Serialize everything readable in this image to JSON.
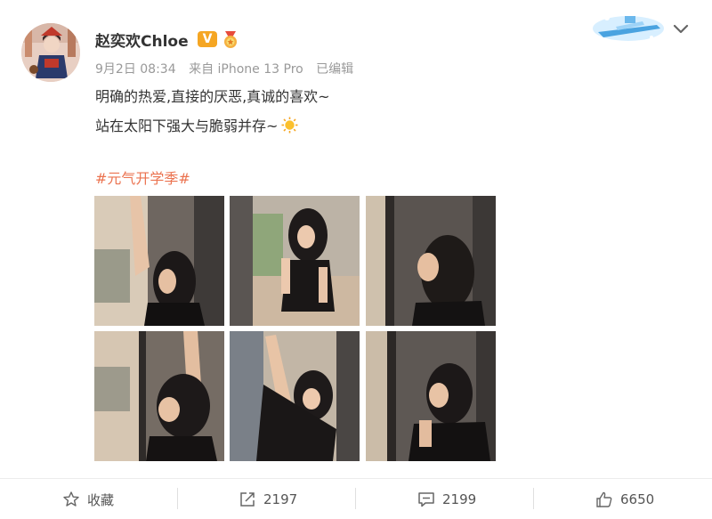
{
  "post": {
    "username": "赵奕欢Chloe",
    "verified_badge": "V",
    "date": "9月2日 08:34",
    "source": "来自 iPhone 13 Pro",
    "edited": "已编辑",
    "line1": "明确的热爱,直接的厌恶,真诚的喜欢~",
    "line2": "站在太阳下强大与脆弱并存~",
    "hashtag": "#元气开学季#"
  },
  "icons": {
    "avatar": "avatar-illustration",
    "medal": "medal-icon",
    "decor": "airship-card-decoration",
    "chevron": "chevron-down-icon",
    "sun": "sun-emoji-icon",
    "star": "star-icon",
    "share": "share-icon",
    "comment": "comment-icon",
    "like": "thumbs-up-icon"
  },
  "colors": {
    "hashtag": "#eb7350",
    "badge": "#f5a623",
    "meta_text": "#999999"
  },
  "actions": {
    "favorite_label": "收藏",
    "repost_count": "2197",
    "comment_count": "2199",
    "like_count": "6650"
  }
}
